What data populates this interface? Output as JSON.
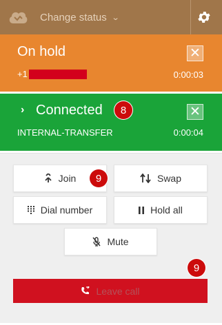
{
  "topbar": {
    "status_label": "Change status",
    "logo_icon": "cloud-phone-logo-icon",
    "dropdown_icon": "chevron-down-icon",
    "settings_icon": "gear-icon",
    "color": "#a0764a"
  },
  "on_hold": {
    "title": "On hold",
    "number_prefix": "+1",
    "timer": "0:00:03",
    "color": "#e8862f",
    "close_label": "✕"
  },
  "connected": {
    "title": "Connected",
    "badge": "8",
    "destination": "INTERNAL-TRANSFER",
    "timer": "0:00:04",
    "color": "#1aa439",
    "close_label": "✕"
  },
  "actions": {
    "join": "Join",
    "join_badge": "9",
    "swap": "Swap",
    "dial_number": "Dial number",
    "hold_all": "Hold all",
    "mute": "Mute"
  },
  "leave": {
    "label": "Leave call",
    "badge": "9",
    "color": "#d0111f"
  }
}
